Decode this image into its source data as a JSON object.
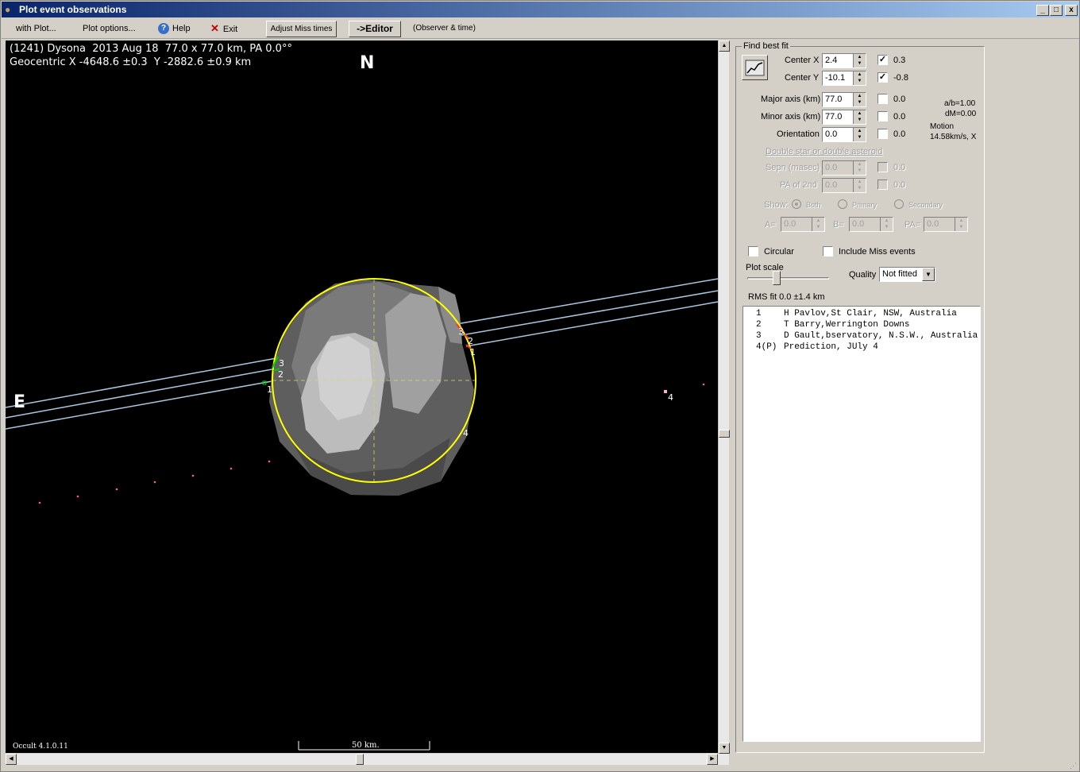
{
  "window": {
    "title": "Plot event observations",
    "app_icon": "tortoise-icon"
  },
  "menu": {
    "with_plot": "with Plot...",
    "plot_options": "Plot options...",
    "help": "Help",
    "exit": "Exit",
    "adjust_miss_times": "Adjust Miss times",
    "editor": "->Editor",
    "observer_time": "(Observer & time)"
  },
  "plot": {
    "header_line1": "(1241) Dysona  2013 Aug 18  77.0 x 77.0 km, PA 0.0°°",
    "header_line2": "Geocentric X -4648.6 ±0.3  Y -2882.6 ±0.9 km",
    "north_label": "N",
    "east_label": "E",
    "version": "Occult 4.1.0.11",
    "scale_label": "50 km.",
    "chord_labels": [
      "1",
      "2",
      "3",
      "1",
      "2",
      "3",
      "4",
      "4"
    ]
  },
  "fit": {
    "group_title": "Find best fit",
    "center_x": {
      "label": "Center X",
      "value": "2.4",
      "checked": true,
      "result": "0.3"
    },
    "center_y": {
      "label": "Center Y",
      "value": "-10.1",
      "checked": true,
      "result": "-0.8"
    },
    "major_axis": {
      "label": "Major axis (km)",
      "value": "77.0",
      "checked": false,
      "result": "0.0"
    },
    "minor_axis": {
      "label": "Minor axis (km)",
      "value": "77.0",
      "checked": false,
      "result": "0.0"
    },
    "orientation": {
      "label": "Orientation",
      "value": "0.0",
      "checked": false,
      "result": "0.0"
    },
    "ab_ratio": "a/b=1.00",
    "dm": "dM=0.00",
    "motion_label": "Motion",
    "motion_value": "14.58km/s, X",
    "double_title": "Double star  or  double asteroid",
    "sepn": {
      "label": "Sepn (masec)",
      "value": "0.0",
      "result": "0.0"
    },
    "pa2": {
      "label": "PA of 2nd",
      "value": "0.0",
      "result": "0.0"
    },
    "show_label": "Show:",
    "show_both": "Both",
    "show_primary": "Primary",
    "show_secondary": "Secondary",
    "a_label": "A=",
    "a_value": "0.0",
    "b_label": "B=",
    "b_value": "0.0",
    "pa_label": "PA=",
    "pa_value": "0.0",
    "circular": "Circular",
    "include_miss": "Include Miss events",
    "plot_scale": "Plot scale",
    "quality_label": "Quality",
    "quality_value": "Not fitted",
    "rms": "RMS fit 0.0 ±1.4 km"
  },
  "observers": [
    {
      "num": "1",
      "name": "H Pavlov,St Clair, NSW, Australia"
    },
    {
      "num": "2",
      "name": "T Barry,Werrington Downs"
    },
    {
      "num": "3",
      "name": "D Gault,bservatory, N.S.W., Australia"
    },
    {
      "num": "4(P)",
      "name": "Prediction, JUly 4"
    }
  ],
  "colors": {
    "limb": "#ffff00",
    "chord": "#a8c8e0",
    "disappear": "#00c000",
    "reappear": "#ff3030",
    "background": "#000000"
  }
}
